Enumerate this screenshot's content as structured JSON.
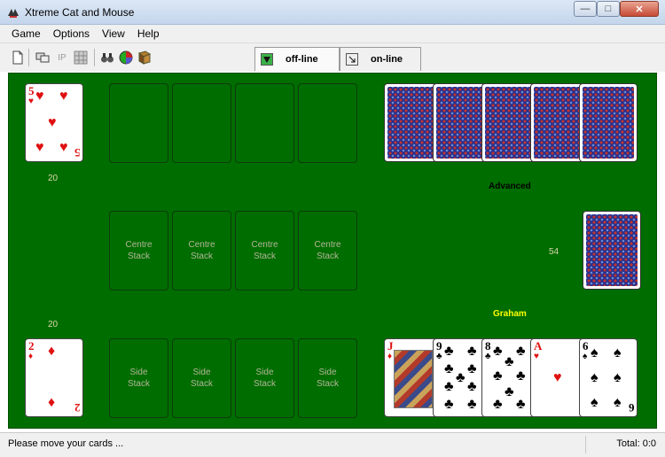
{
  "window": {
    "title": "Xtreme Cat and Mouse",
    "minimize_icon": "minimize-icon",
    "maximize_icon": "maximize-icon",
    "close_icon": "close-icon"
  },
  "menu": [
    "Game",
    "Options",
    "View",
    "Help"
  ],
  "toolbar": {
    "ip_label": "IP",
    "icons": [
      "new-document-icon",
      "network-computer-icon",
      "ip-icon",
      "grid-icon",
      "binoculars-icon",
      "color-wheel-icon",
      "book-icon"
    ],
    "tabs": [
      {
        "label": "off-line",
        "icon": "play-down-icon",
        "active": true
      },
      {
        "label": "on-line",
        "icon": "arrow-icon",
        "active": false
      }
    ]
  },
  "game": {
    "table_color": "#006d00",
    "top_player": {
      "card": {
        "rank": "5",
        "suit": "heart"
      },
      "pile_count": "20",
      "name": "Advanced",
      "hand_backs": 5
    },
    "bottom_player": {
      "card": {
        "rank": "2",
        "suit": "diamond"
      },
      "pile_count": "20",
      "name": "Graham",
      "hand": [
        {
          "rank": "J",
          "suit": "diamond"
        },
        {
          "rank": "9",
          "suit": "club"
        },
        {
          "rank": "8",
          "suit": "club"
        },
        {
          "rank": "A",
          "suit": "heart"
        },
        {
          "rank": "6",
          "suit": "spade"
        }
      ]
    },
    "top_slots": 4,
    "centre_stacks": [
      "Centre\nStack",
      "Centre\nStack",
      "Centre\nStack",
      "Centre\nStack"
    ],
    "side_stacks": [
      "Side\nStack",
      "Side\nStack",
      "Side\nStack",
      "Side\nStack"
    ],
    "deck_count": "54",
    "name_colors": {
      "top": "#000000",
      "bottom": "#ffff00"
    }
  },
  "status": {
    "message": "Please move your cards ...",
    "total": "Total: 0:0"
  }
}
